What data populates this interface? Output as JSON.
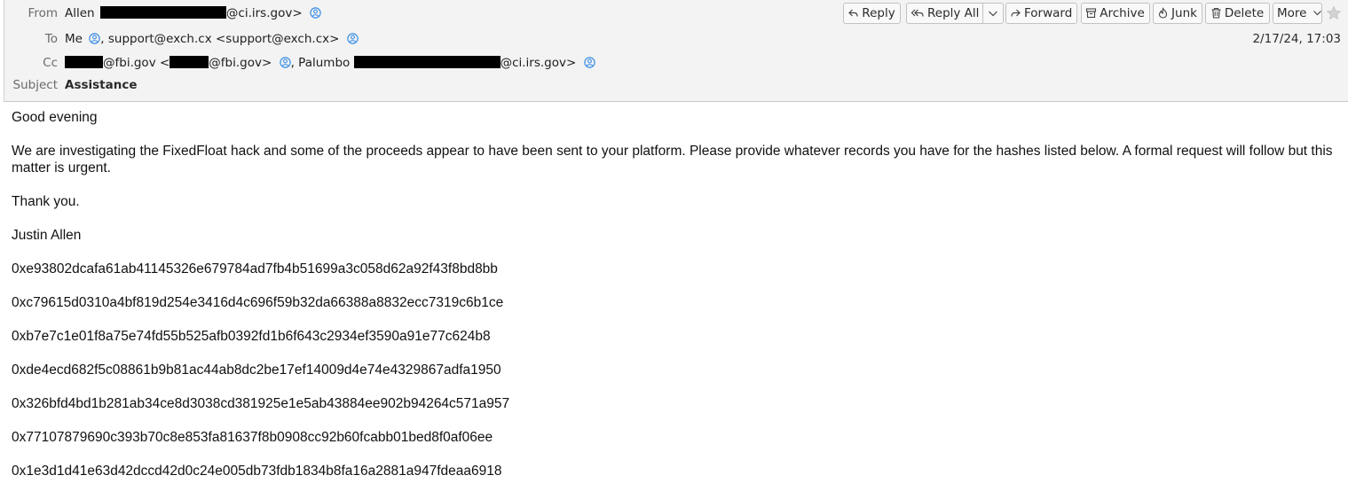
{
  "header": {
    "from_label": "From",
    "from_name": "Allen",
    "from_domain": "@ci.irs.gov>",
    "to_label": "To",
    "to_me": "Me",
    "to_rest": ", support@exch.cx <support@exch.cx>",
    "cc_label": "Cc",
    "cc_part1": "@fbi.gov <",
    "cc_part2": "@fbi.gov>",
    "cc_part3": ", Palumbo",
    "cc_part4": "@ci.irs.gov>",
    "subject_label": "Subject",
    "subject": "Assistance",
    "date": "2/17/24, 17:03"
  },
  "toolbar": {
    "reply": "Reply",
    "reply_all": "Reply All",
    "forward": "Forward",
    "archive": "Archive",
    "junk": "Junk",
    "delete": "Delete",
    "more": "More"
  },
  "message": {
    "greeting": "Good evening",
    "paragraph": "We are investigating the FixedFloat hack and some of the proceeds appear to have been sent to your platform. Please provide whatever records you have for the hashes listed below. A formal request will follow but this matter is urgent.",
    "thanks": "Thank you.",
    "signature": "Justin Allen",
    "hashes": [
      "0xe93802dcafa61ab41145326e679784ad7fb4b51699a3c058d62a92f43f8bd8bb",
      "0xc79615d0310a4bf819d254e3416d4c696f59b32da66388a8832ecc7319c6b1ce",
      "0xb7e7c1e01f8a75e74fd55b525afb0392fd1b6f643c2934ef3590a91e77c624b8",
      "0xde4ecd682f5c08861b9b81ac44ab8dc2be17ef14009d4e74e4329867adfa1950",
      "0x326bfd4bd1b281ab34ce8d3038cd381925e1e5ab43884ee902b94264c571a957",
      "0x77107879690c393b70c8e853fa81637f8b0908cc92b60fcabb01bed8f0af06ee",
      "0x1e3d1d41e63d42dccd42d0c24e005db73fdb1834b8fa16a2881a947fdeaa6918"
    ]
  },
  "colors": {
    "header_bg": "#f3f3f3",
    "contact_icon": "#3a8ee6"
  },
  "icons": {
    "contact": "person-circle-icon",
    "reply": "reply-arrow-icon",
    "reply_all": "reply-all-arrow-icon",
    "forward": "forward-arrow-icon",
    "archive": "archive-box-icon",
    "junk": "flame-icon",
    "delete": "trash-icon",
    "more": "chevron-down-icon",
    "star": "star-icon"
  }
}
